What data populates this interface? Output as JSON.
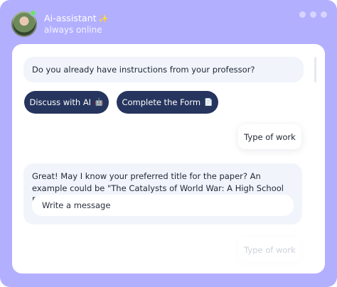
{
  "header": {
    "assistant_name": "Ai-assistant",
    "sparkle_icon": "✨",
    "status": "always online"
  },
  "chat": {
    "question_1": "Do you already have instructions from your professor?",
    "buttons": {
      "discuss": "Discuss with AI",
      "discuss_icon": "🤖",
      "complete_form": "Complete the Form",
      "form_icon": "📄"
    },
    "user_reply_1": "Type of work",
    "question_2": "Great! May I know your preferred title for the paper? An example could be \"The Catalysts of World War: A High School Perspective\".",
    "input_placeholder": "Write a message",
    "user_reply_2": "Type of work"
  },
  "colors": {
    "frame": "#b3afff",
    "button": "#26355e",
    "bot_bubble": "#f1f5fb"
  }
}
